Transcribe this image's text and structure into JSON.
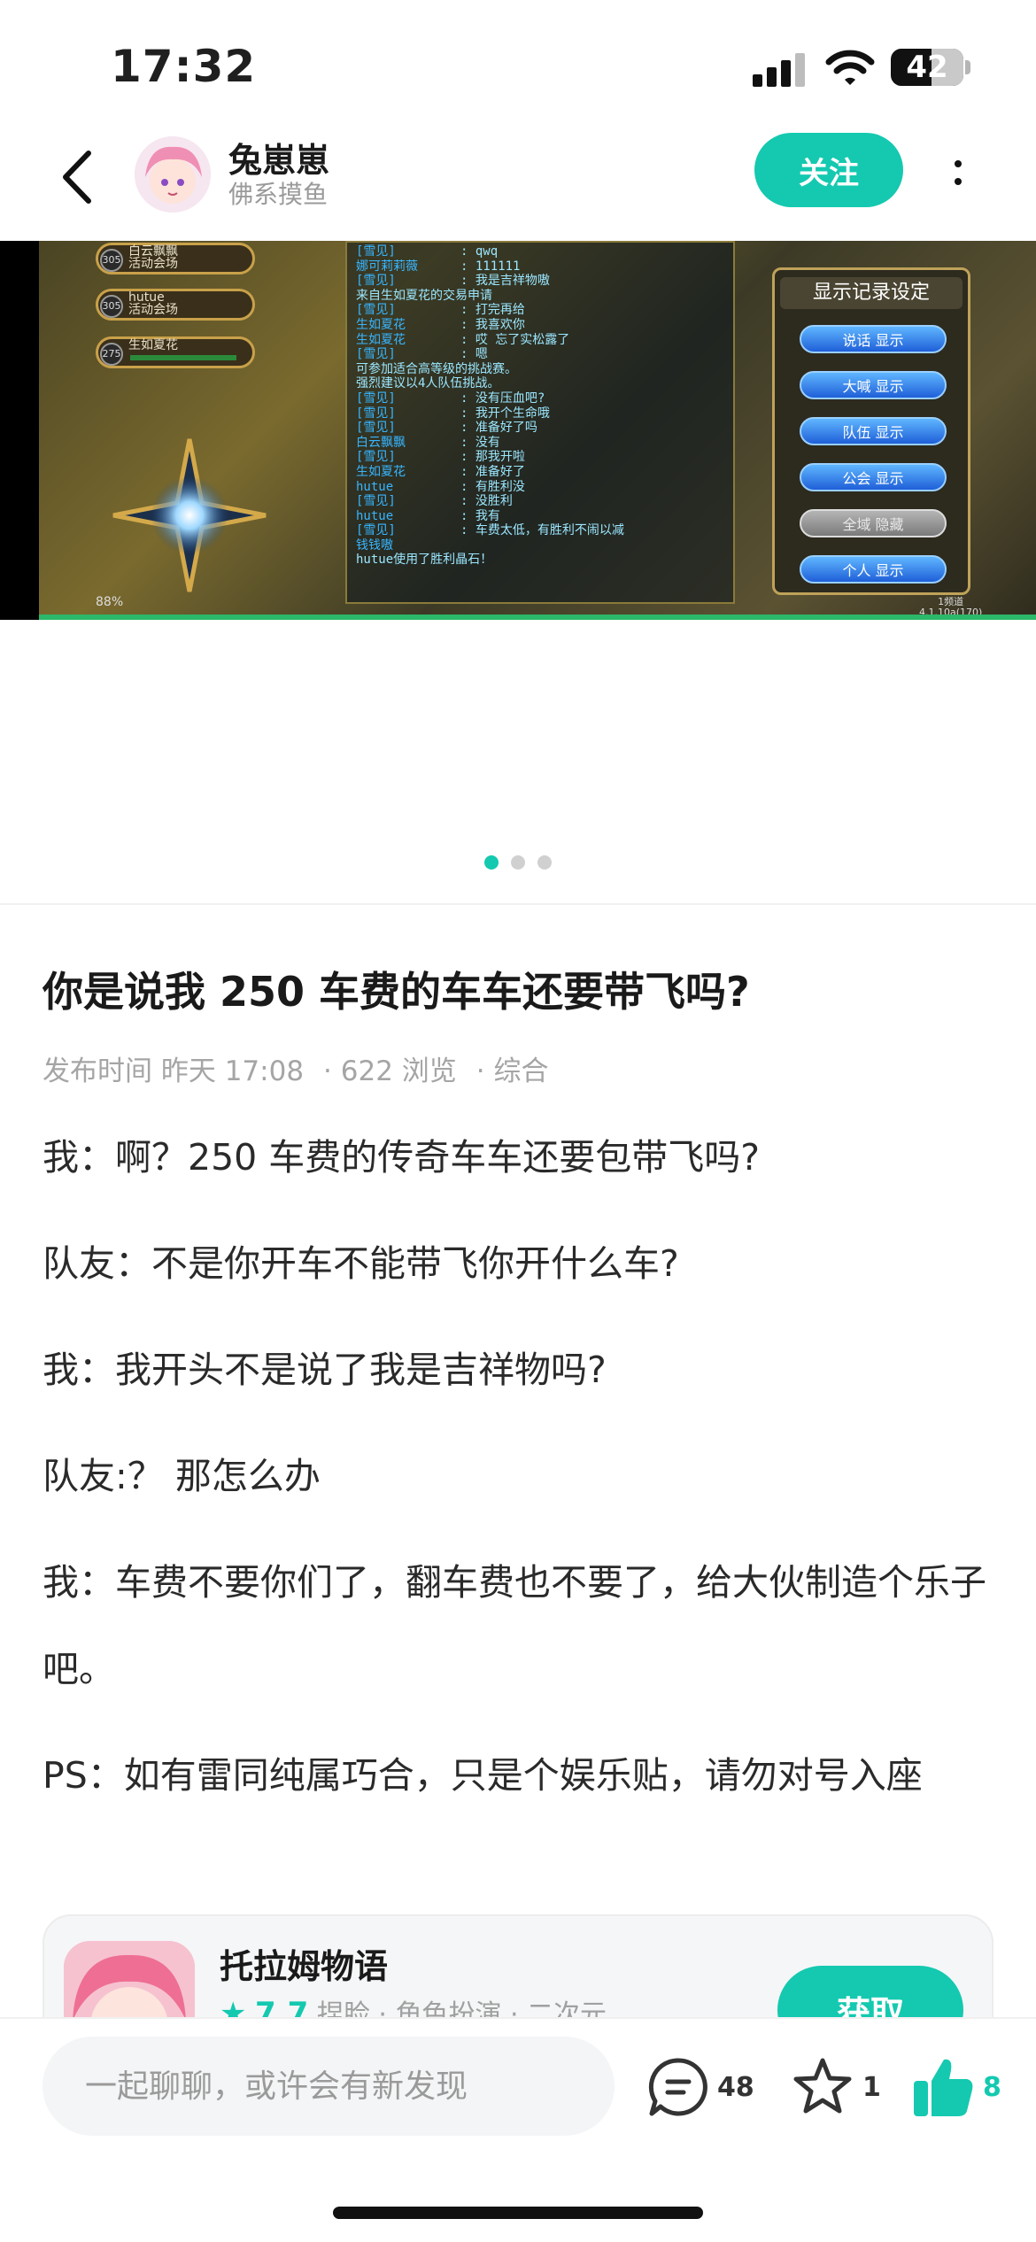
{
  "status_bar": {
    "time": "17:32",
    "battery": "42"
  },
  "header": {
    "author_name": "兔崽崽",
    "author_sub": "佛系摸鱼",
    "follow_label": "关注"
  },
  "media": {
    "party": [
      {
        "level": "305",
        "name": "白云飘飘",
        "sub": "活动会场"
      },
      {
        "level": "305",
        "name": "hutue",
        "sub": "活动会场"
      },
      {
        "level": "275",
        "name": "生如夏花",
        "sub": ""
      }
    ],
    "chat": [
      {
        "who": "[雪见]",
        "msg": ": qwq",
        "style": ""
      },
      {
        "who": "娜可莉莉薇",
        "msg": ": 111111",
        "style": ""
      },
      {
        "who": "[雪见]",
        "msg": ": 我是吉祥物嗷",
        "style": ""
      },
      {
        "who": "",
        "msg": "来自生如夏花的交易申请",
        "style": "red"
      },
      {
        "who": "[雪见]",
        "msg": ": 打完再给",
        "style": ""
      },
      {
        "who": "生如夏花",
        "msg": ": 我喜欢你",
        "style": ""
      },
      {
        "who": "生如夏花",
        "msg": ": 哎 忘了实松露了",
        "style": ""
      },
      {
        "who": "[雪见]",
        "msg": ": 嗯",
        "style": ""
      },
      {
        "who": "",
        "msg": "可参加适合高等级的挑战赛。",
        "style": "lime"
      },
      {
        "who": "",
        "msg": "强烈建议以4人队伍挑战。",
        "style": "red"
      },
      {
        "who": "[雪见]",
        "msg": ": 没有压血吧?",
        "style": ""
      },
      {
        "who": "[雪见]",
        "msg": ": 我开个生命哦",
        "style": ""
      },
      {
        "who": "[雪见]",
        "msg": ": 准备好了吗",
        "style": ""
      },
      {
        "who": "白云飘飘",
        "msg": ": 没有",
        "style": ""
      },
      {
        "who": "[雪见]",
        "msg": ": 那我开啦",
        "style": ""
      },
      {
        "who": "生如夏花",
        "msg": ": 准备好了",
        "style": ""
      },
      {
        "who": "hutue",
        "msg": ": 有胜利没",
        "style": ""
      },
      {
        "who": "[雪见]",
        "msg": ": 没胜利",
        "style": ""
      },
      {
        "who": "hutue",
        "msg": ": 我有",
        "style": ""
      },
      {
        "who": "[雪见]",
        "msg": ": 车费太低，有胜利不闹以减",
        "style": ""
      },
      {
        "who": "钱钱嗷",
        "msg": "",
        "style": ""
      },
      {
        "who": "",
        "msg": "hutue使用了胜利晶石！",
        "style": "sys"
      }
    ],
    "record_title": "显示记录设定",
    "record_buttons": [
      {
        "label": "说话 显示",
        "off": false
      },
      {
        "label": "大喊 显示",
        "off": false
      },
      {
        "label": "队伍 显示",
        "off": false
      },
      {
        "label": "公会 显示",
        "off": false
      },
      {
        "label": "全域 隐藏",
        "off": true
      },
      {
        "label": "个人 显示",
        "off": false
      }
    ],
    "hp_pct": "88%",
    "channel": "1频道",
    "version": "4.1.10a(170)"
  },
  "pager": {
    "count": 3,
    "active": 0
  },
  "post": {
    "title": "你是说我 250 车费的车车还要带飞吗?",
    "meta_time": "发布时间 昨天 17:08",
    "meta_views": "· 622 浏览",
    "meta_category": "· 综合",
    "paragraphs": [
      "我：啊？250 车费的传奇车车还要包带飞吗?",
      "队友：不是你开车不能带飞你开什么车?",
      "我：我开头不是说了我是吉祥物吗?",
      "队友:？ 那怎么办",
      "我：车费不要你们了，翻车费也不要了，给大伙制造个乐子吧。",
      "PS：如有雷同纯属巧合，只是个娱乐贴，请勿对号入座"
    ]
  },
  "app_card": {
    "name": "托拉姆物语",
    "rating": "7.7",
    "tags": "捏脸 · 角色扮演 · 二次元",
    "get_label": "获取"
  },
  "bottom_bar": {
    "input_placeholder": "一起聊聊，或许会有新发现",
    "comments": "48",
    "favorites": "1",
    "likes": "8"
  },
  "colors": {
    "accent": "#14c9b0",
    "text": "#1a1a1a",
    "muted": "#a5a5a5"
  }
}
